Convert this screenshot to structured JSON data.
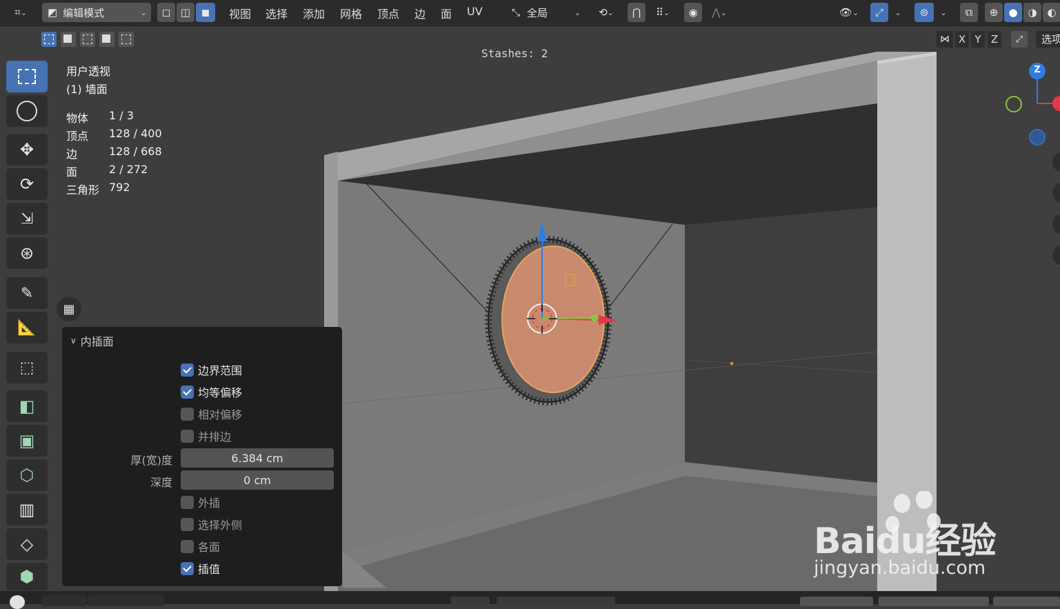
{
  "header": {
    "mode_label": "编辑模式",
    "menus": [
      "视图",
      "选择",
      "添加",
      "网格",
      "顶点",
      "边",
      "面",
      "UV"
    ],
    "transform_orientation": "全局",
    "options_label": "选项",
    "axis_x": "X",
    "axis_y": "Y",
    "axis_z": "Z"
  },
  "viewport": {
    "stashes": "Stashes: 2",
    "view_name": "用户透视",
    "object_name": "(1) 墙面",
    "stats": [
      {
        "label": "物体",
        "value": "1 / 3"
      },
      {
        "label": "顶点",
        "value": "128 / 400"
      },
      {
        "label": "边",
        "value": "128 / 668"
      },
      {
        "label": "面",
        "value": "2 / 272"
      },
      {
        "label": "三角形",
        "value": "792"
      }
    ],
    "gizmo_z": "Z"
  },
  "operator_panel": {
    "title": "内插面",
    "options": [
      {
        "label": "边界范围",
        "checked": true
      },
      {
        "label": "均等偏移",
        "checked": true
      },
      {
        "label": "相对偏移",
        "checked": false
      },
      {
        "label": "并排边",
        "checked": false
      }
    ],
    "thickness_label": "厚(宽)度",
    "thickness_value": "6.384 cm",
    "depth_label": "深度",
    "depth_value": "0 cm",
    "options2": [
      {
        "label": "外插",
        "checked": false
      },
      {
        "label": "选择外侧",
        "checked": false
      },
      {
        "label": "各面",
        "checked": false
      },
      {
        "label": "插值",
        "checked": true
      }
    ]
  },
  "watermark": {
    "brand": "Baidu经验",
    "url": "jingyan.baidu.com"
  },
  "colors": {
    "accent": "#4772b3",
    "selection_face": "#c88a6e",
    "gizmo_x": "#e8364f",
    "gizmo_y": "#8bc53f",
    "gizmo_z": "#2f7de1"
  }
}
